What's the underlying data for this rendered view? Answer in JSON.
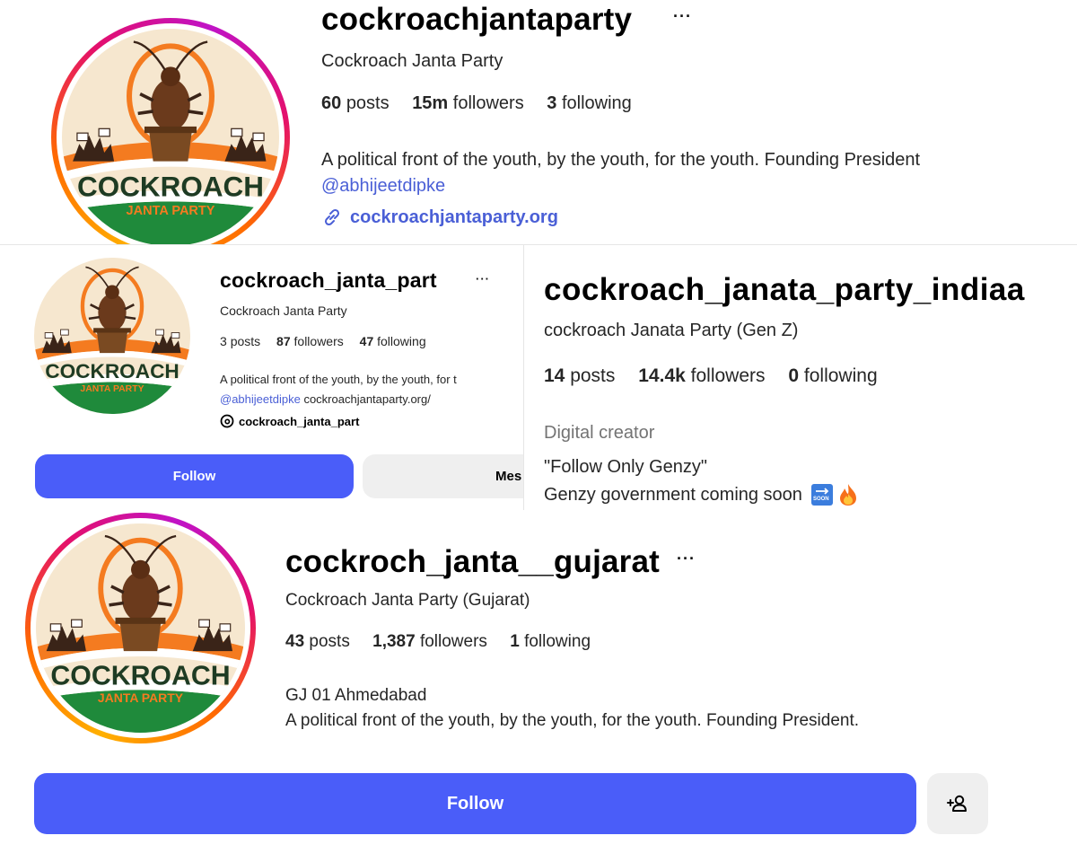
{
  "profile_1": {
    "username": "cockroachjantaparty",
    "more": "···",
    "full_name": "Cockroach Janta Party",
    "stats": {
      "posts_count": "60",
      "posts_label": "posts",
      "followers_count": "15m",
      "followers_label": "followers",
      "following_count": "3",
      "following_label": "following"
    },
    "bio_line": "A political front of the youth, by the youth, for the youth. Founding President",
    "bio_mention": "@abhijeetdipke",
    "website": "cockroachjantaparty.org",
    "avatar": {
      "logo_text": "COCKROACH",
      "logo_subtext": "JANTA PARTY"
    }
  },
  "profile_2": {
    "username": "cockroach_janta_part",
    "more": "···",
    "full_name": "Cockroach Janta Party",
    "stats": {
      "posts_count": "3",
      "posts_label": "posts",
      "followers_count": "87",
      "followers_label": "followers",
      "following_count": "47",
      "following_label": "following"
    },
    "bio_line": "A political front of the youth, by the youth, for t",
    "bio_mention": "@abhijeetdipke",
    "bio_link": "cockroachjantaparty.org/",
    "threads_handle": "cockroach_janta_part",
    "follow_label": "Follow",
    "message_label": "Mes",
    "avatar": {
      "logo_text": "COCKROACH",
      "logo_subtext": "JANTA PARTY"
    }
  },
  "profile_3": {
    "username": "cockroach_janata_party_indiaa",
    "full_name": "cockroach Janata Party (Gen Z)",
    "stats": {
      "posts_count": "14",
      "posts_label": "posts",
      "followers_count": "14.4k",
      "followers_label": "followers",
      "following_count": "0",
      "following_label": "following"
    },
    "category": "Digital creator",
    "bio_line_1": "\"Follow Only Genzy\"",
    "bio_line_2": "Genzy government coming soon",
    "soon_emoji_text": "SOON"
  },
  "profile_4": {
    "username": "cockroch_janta__gujarat",
    "more": "···",
    "full_name": "Cockroach Janta Party (Gujarat)",
    "stats": {
      "posts_count": "43",
      "posts_label": "posts",
      "followers_count": "1,387",
      "followers_label": "followers",
      "following_count": "1",
      "following_label": "following"
    },
    "bio_line_1": "GJ 01 Ahmedabad",
    "bio_line_2": "A political front of the youth, by the youth, for the youth. Founding President.",
    "follow_label": "Follow",
    "avatar": {
      "logo_text": "COCKROACH",
      "logo_subtext": "JANTA PARTY"
    }
  },
  "colors": {
    "follow_button": "#4a5df9",
    "link": "#4a5fd6",
    "saffron": "#f47b20",
    "green": "#1f8a3b",
    "logo_text": "#1e3b23"
  }
}
